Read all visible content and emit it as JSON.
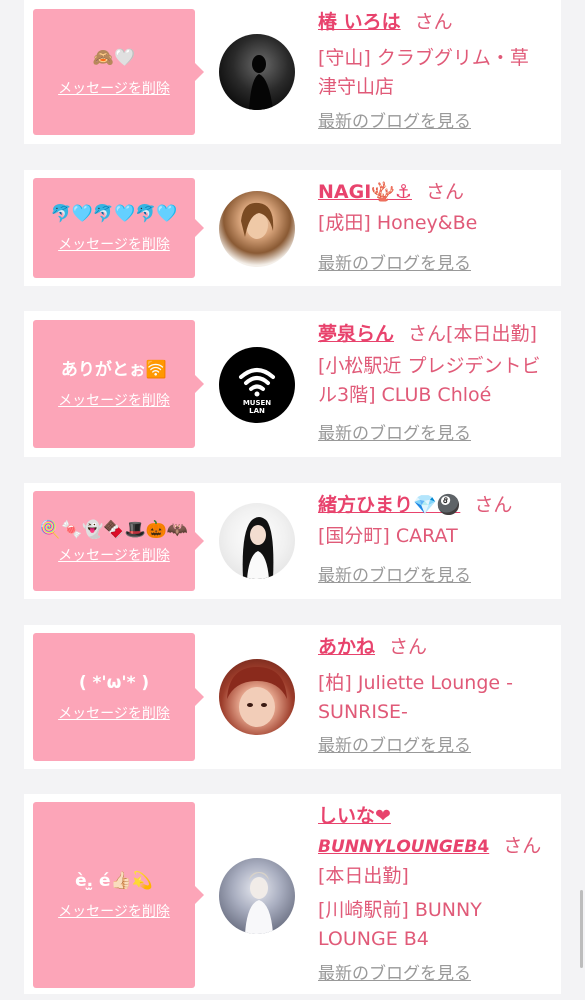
{
  "delete_label": "メッセージを削除",
  "blog_label": "最新のブログを見る",
  "san": "さん",
  "items": [
    {
      "message": "🙈🤍",
      "name": "椿 いろは",
      "status": "",
      "shop_lines": [
        "[守山] クラブグリム・草",
        "津守山店"
      ]
    },
    {
      "message": "🐬🩵🐬🩵🐬🩵",
      "name": "NAGI🪸⚓",
      "status": "",
      "shop_lines": [
        "[成田] Honey&Be"
      ]
    },
    {
      "message": "ありがとぉ🛜",
      "name": "夢泉らん",
      "status": "[本日出勤]",
      "shop_lines": [
        "[小松駅近 プレジデントビ",
        "ル3階] CLUB Chloé"
      ],
      "avatar_text": "MUSEN LAN"
    },
    {
      "message": "🍭🍬👻🍫🎩🎃🦇",
      "name": "緒方ひまり💎🎱",
      "status": "",
      "shop_lines": [
        "[国分町] CARAT"
      ]
    },
    {
      "message": "( *'ω'* )",
      "name": "あかね",
      "status": "",
      "shop_lines": [
        "[柏] Juliette Lounge -",
        "SUNRISE-"
      ]
    },
    {
      "message": "è.̫ é👍🏻💫",
      "name": "しいな❤",
      "name2": "𝘽𝙐𝙉𝙉𝙔𝙇𝙊𝙐𝙉𝙂𝙀𝘽4",
      "status": "[本日出勤]",
      "shop_lines": [
        "[川崎駅前] BUNNY",
        "LOUNGE B4"
      ]
    }
  ]
}
